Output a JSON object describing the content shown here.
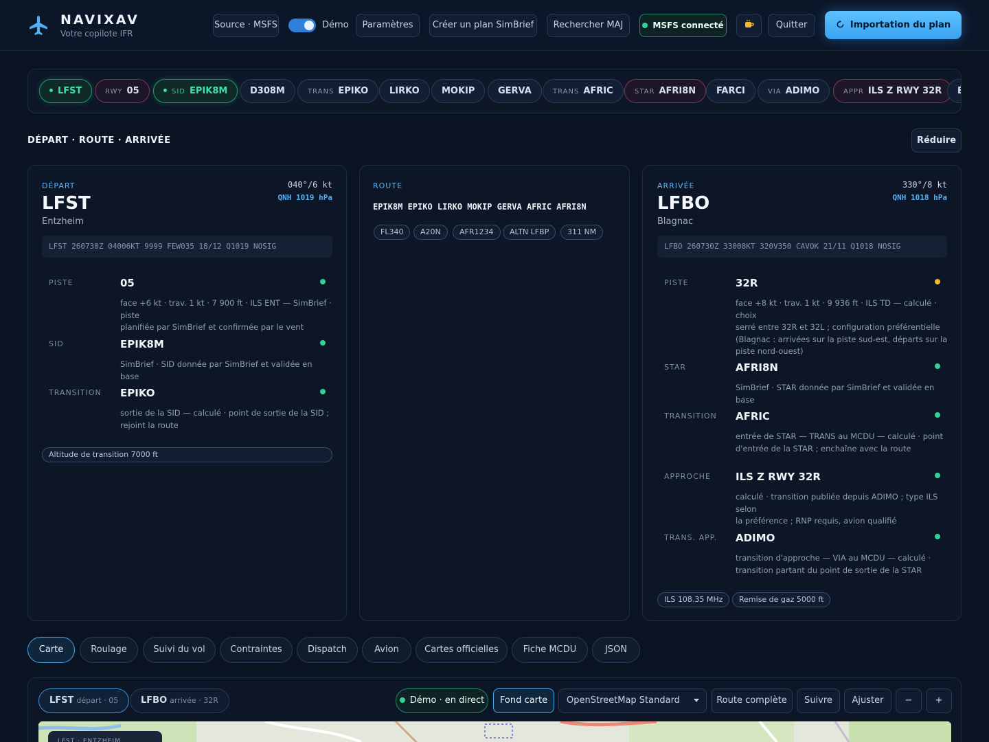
{
  "header": {
    "app_name": "NAVIXAV",
    "app_subtitle": "Votre copilote IFR",
    "source_btn": "Source · MSFS",
    "demo_label": "Démo",
    "settings_btn": "Paramètres",
    "simbrief_btn": "Créer un plan SimBrief",
    "updates_btn": "Rechercher MAJ",
    "msfs_status": "MSFS connecté",
    "quit_btn": "Quitter",
    "import_btn": "Importation du plan",
    "accent_color": "#4fb0f6"
  },
  "route_strip": [
    {
      "pre": "",
      "label": "LFST",
      "style": "green",
      "dot": true
    },
    {
      "pre": "RWY",
      "label": "05",
      "style": "pink",
      "dot": false
    },
    {
      "pre": "SID",
      "label": "EPIK8M",
      "style": "green",
      "dot": true
    },
    {
      "pre": "",
      "label": "D308M",
      "style": "",
      "dot": false
    },
    {
      "pre": "TRANS",
      "label": "EPIKO",
      "style": "",
      "dot": false
    },
    {
      "pre": "",
      "label": "LIRKO",
      "style": "",
      "dot": false
    },
    {
      "pre": "",
      "label": "MOKIP",
      "style": "",
      "dot": false
    },
    {
      "pre": "",
      "label": "GERVA",
      "style": "",
      "dot": false
    },
    {
      "pre": "TRANS",
      "label": "AFRIC",
      "style": "",
      "dot": false
    },
    {
      "pre": "STAR",
      "label": "AFRI8N",
      "style": "pink",
      "dot": false
    },
    {
      "pre": "",
      "label": "FARCI",
      "style": "",
      "dot": false
    },
    {
      "pre": "VIA",
      "label": "ADIMO",
      "style": "",
      "dot": false
    },
    {
      "pre": "APPR",
      "label": "ILS Z RWY 32R",
      "style": "pink",
      "dot": false
    },
    {
      "pre": "",
      "label": "B",
      "style": "",
      "dot": false
    }
  ],
  "section": {
    "title": "DÉPART · ROUTE · ARRIVÉE",
    "reduce_btn": "Réduire"
  },
  "departure": {
    "kicker": "DÉPART",
    "code": "LFST",
    "city": "Entzheim",
    "wind": "040°/6 kt",
    "qnh": "QNH 1019 hPa",
    "metar": "LFST 260730Z 04006KT 9999 FEW035 18/12 Q1019 NOSIG",
    "rows": [
      {
        "label": "PISTE",
        "value": "05",
        "desc": [
          "face +6 kt · trav. 1 kt · 7 900 ft · ILS ENT — SimBrief · piste",
          "planifiée par SimBrief et confirmée par le vent"
        ]
      },
      {
        "label": "SID",
        "value": "EPIK8M",
        "desc": [
          "SimBrief · SID donnée par SimBrief et validée en base"
        ]
      },
      {
        "label": "TRANSITION",
        "value": "EPIKO",
        "desc": [
          "sortie de la SID — calculé · point de sortie de la SID ;",
          "rejoint la route"
        ]
      }
    ],
    "tag": "Altitude de transition 7000 ft"
  },
  "route": {
    "kicker": "ROUTE",
    "string": "EPIK8M EPIKO LIRKO MOKIP GERVA AFRIC AFRI8N",
    "tags": [
      "FL340",
      "A20N",
      "AFR1234",
      "ALTN LFBP",
      "311 NM"
    ]
  },
  "arrival": {
    "kicker": "ARRIVÉE",
    "code": "LFBO",
    "city": "Blagnac",
    "wind": "330°/8 kt",
    "qnh": "QNH 1018 hPa",
    "metar": "LFBO 260730Z 33008KT 320V350 CAVOK 21/11 Q1018 NOSIG",
    "rows": [
      {
        "label": "PISTE",
        "value": "32R",
        "status": "amber",
        "desc": [
          "face +8 kt · trav. 1 kt · 9 936 ft · ILS TD — calculé · choix",
          "serré entre 32R et 32L ; configuration préférentielle",
          "(Blagnac : arrivées sur la piste sud-est, départs sur la",
          "piste nord-ouest)"
        ]
      },
      {
        "label": "STAR",
        "value": "AFRI8N",
        "status": "green",
        "desc": [
          "SimBrief · STAR donnée par SimBrief et validée en base"
        ]
      },
      {
        "label": "TRANSITION",
        "value": "AFRIC",
        "status": "green",
        "desc": [
          "entrée de STAR — TRANS au MCDU — calculé · point",
          "d'entrée de la STAR ; enchaîne avec la route"
        ]
      },
      {
        "label": "APPROCHE",
        "value": "ILS Z RWY 32R",
        "status": "green",
        "desc": [
          "calculé · transition publiée depuis ADIMO ; type ILS selon",
          "la préférence ; RNP requis, avion qualifié"
        ]
      },
      {
        "label": "TRANS. APP.",
        "value": "ADIMO",
        "status": "green",
        "desc": [
          "transition d'approche — VIA au MCDU — calculé ·",
          "transition partant du point de sortie de la STAR"
        ]
      }
    ],
    "tags": [
      "ILS 108.35 MHz",
      "Remise de gaz 5000 ft"
    ]
  },
  "tabs": [
    "Carte",
    "Roulage",
    "Suivi du vol",
    "Contraintes",
    "Dispatch",
    "Avion",
    "Cartes officielles",
    "Fiche MCDU",
    "JSON"
  ],
  "active_tab": "Carte",
  "map": {
    "dep_chip": {
      "code": "LFST",
      "sub": "départ · 05"
    },
    "arr_chip": {
      "code": "LFBO",
      "sub": "arrivée · 32R"
    },
    "live": "Démo · en direct",
    "basemap_btn": "Fond carte",
    "basemap_select": "OpenStreetMap Standard",
    "full_route_btn": "Route complète",
    "follow_btn": "Suivre",
    "fit_btn": "Ajuster",
    "zoom_out": "−",
    "zoom_in": "+",
    "overlay_label": "LFST · ENTZHEIM"
  }
}
